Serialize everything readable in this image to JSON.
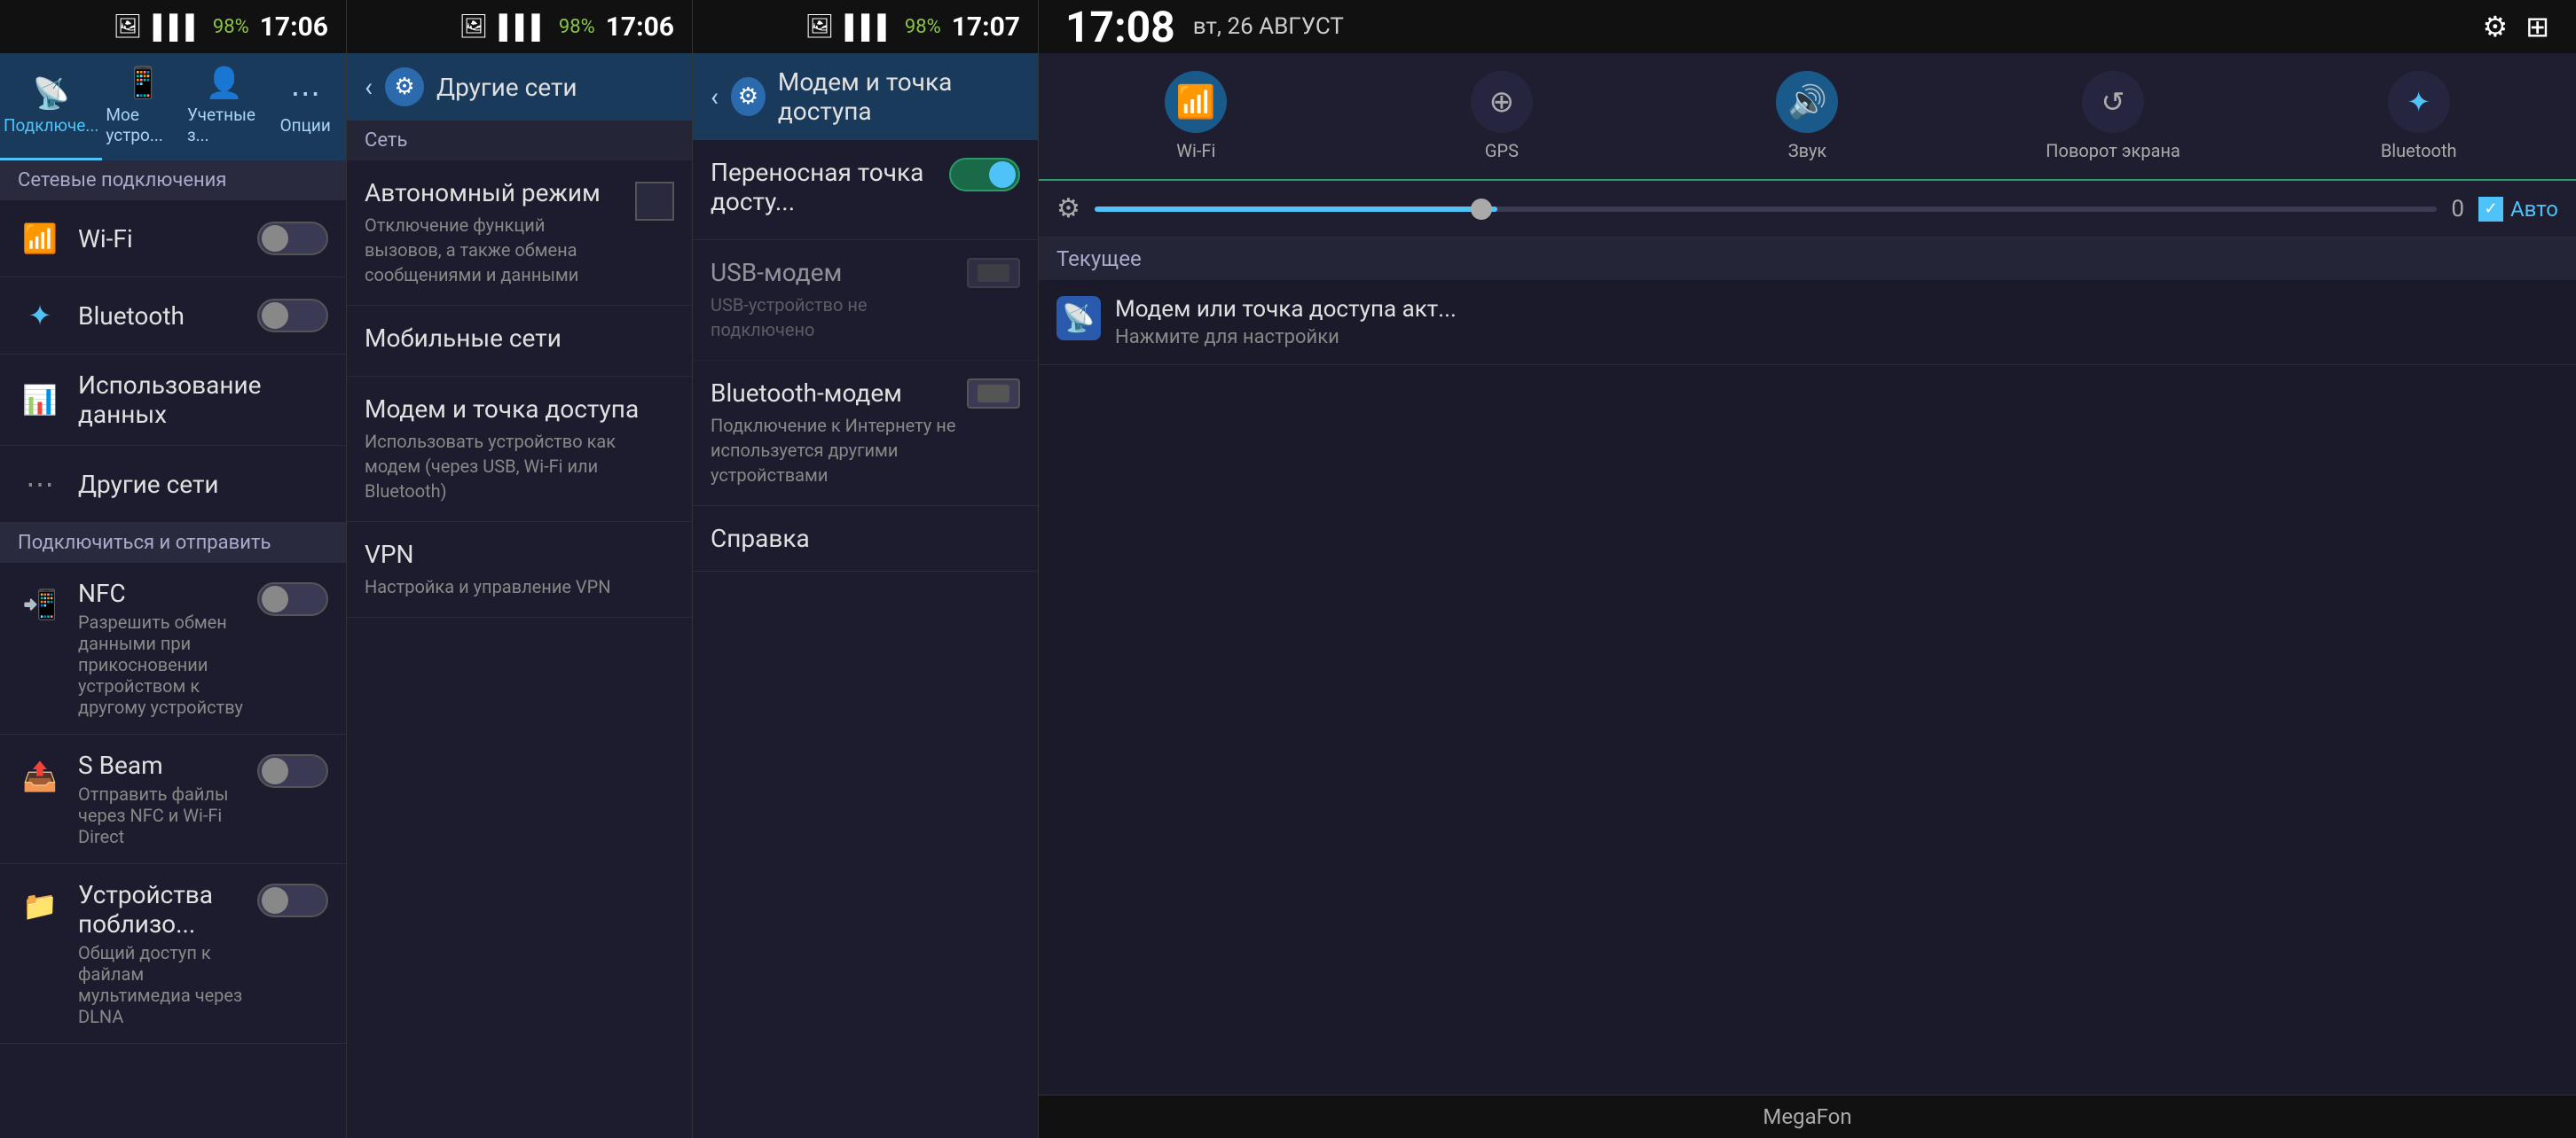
{
  "panel1": {
    "status_bar": {
      "signal": "▌▌▌▌",
      "battery_pct": "98%",
      "time": "17:06",
      "image_icon": "🖼"
    },
    "tabs": [
      {
        "id": "connections",
        "icon": "📡",
        "label": "Подключе...",
        "active": true
      },
      {
        "id": "my-device",
        "icon": "📱",
        "label": "Мое устро..."
      },
      {
        "id": "accounts",
        "icon": "👤",
        "label": "Учетные з..."
      },
      {
        "id": "options",
        "icon": "⋯",
        "label": "Опции"
      }
    ],
    "section_network": "Сетевые подключения",
    "items": [
      {
        "icon": "wifi",
        "title": "Wi-Fi",
        "toggle": true,
        "toggle_on": false
      },
      {
        "icon": "bluetooth",
        "title": "Bluetooth",
        "toggle": true,
        "toggle_on": false
      },
      {
        "icon": "data",
        "title": "Использование данных",
        "toggle": false
      },
      {
        "icon": "other",
        "title": "Другие сети",
        "toggle": false
      }
    ],
    "section_connect": "Подключиться и отправить",
    "connect_items": [
      {
        "icon": "nfc",
        "title": "NFC",
        "desc": "Разрешить обмен данными при прикосновении устройством к другому устройству",
        "toggle": true,
        "toggle_on": false
      },
      {
        "icon": "sbeam",
        "title": "S Beam",
        "desc": "Отправить файлы через NFC и Wi-Fi Direct",
        "toggle": true,
        "toggle_on": false
      },
      {
        "icon": "nearby",
        "title": "Устройства поблизо...",
        "desc": "Общий доступ к файлам мультимедиа через DLNA",
        "toggle": true,
        "toggle_on": false
      }
    ]
  },
  "panel2": {
    "status_bar": {
      "signal": "▌▌▌▌",
      "battery_pct": "98%",
      "time": "17:06",
      "image_icon": "🖼"
    },
    "header": {
      "back": "‹",
      "icon": "⚙",
      "title": "Другие сети"
    },
    "section": "Сеть",
    "items": [
      {
        "title": "Автономный режим",
        "desc": "Отключение функций вызовов, а также обмена сообщениями и данными",
        "has_toggle": true
      },
      {
        "title": "Мобильные сети",
        "desc": "",
        "has_toggle": false
      },
      {
        "title": "Модем и точка доступа",
        "desc": "Использовать устройство как модем (через USB, Wi-Fi или Bluetooth)",
        "has_toggle": false
      },
      {
        "title": "VPN",
        "desc": "Настройка и управление VPN",
        "has_toggle": false
      }
    ]
  },
  "panel3": {
    "status_bar": {
      "signal": "▌▌▌▌",
      "battery_pct": "98%",
      "time": "17:07",
      "image_icon": "🖼"
    },
    "header": {
      "back": "‹",
      "icon": "⚙",
      "title": "Модем и точка доступа"
    },
    "items": [
      {
        "title": "Переносная точка досту...",
        "desc": "",
        "toggle": "on"
      },
      {
        "title": "USB-модем",
        "desc": "USB-устройство не подключено",
        "toggle": "checkbox-off",
        "disabled": true
      },
      {
        "title": "Bluetooth-модем",
        "desc": "Подключение к Интернету не используется другими устройствами",
        "toggle": "checkbox-off"
      }
    ],
    "справка": "Справка"
  },
  "panel4": {
    "status_bar": {
      "time": "17:08",
      "date": "вт, 26 АВГУСТ",
      "icons": [
        "⚙",
        "⊞"
      ]
    },
    "quick_toggles": [
      {
        "id": "wifi",
        "icon": "📶",
        "label": "Wi-Fi",
        "active": true
      },
      {
        "id": "gps",
        "icon": "◎",
        "label": "GPS",
        "active": false
      },
      {
        "id": "sound",
        "icon": "🔊",
        "label": "Звук",
        "active": true
      },
      {
        "id": "rotate",
        "icon": "↺",
        "label": "Поворот экрана",
        "active": false
      },
      {
        "id": "bluetooth",
        "icon": "🔷",
        "label": "Bluetooth",
        "active": false
      }
    ],
    "brightness": {
      "value": "0",
      "auto_label": "Авто",
      "auto_checked": true
    },
    "section_current": "Текущее",
    "notifications": [
      {
        "icon": "📡",
        "title": "Модем или точка доступа акт...",
        "subtitle": "Нажмите для настройки"
      }
    ],
    "carrier": "MegaFon"
  }
}
